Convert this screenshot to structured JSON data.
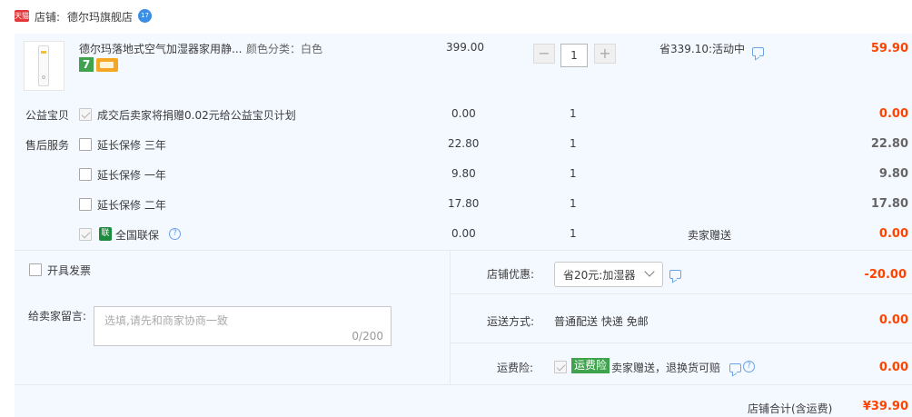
{
  "shop": {
    "badge": "天猫",
    "label": "店铺:",
    "name": "德尔玛旗舰店",
    "wangwang_badge": "17"
  },
  "product": {
    "title": "德尔玛落地式空气加湿器家用静...",
    "sku": "颜色分类：白色",
    "badge_7": "7",
    "price": "399.00",
    "quantity": "1",
    "minus": "−",
    "plus": "+",
    "discount": "省339.10:活动中",
    "subtotal": "59.90"
  },
  "extras": {
    "charity_label": "公益宝贝",
    "charity_text": "成交后卖家将捐赠0.02元给公益宝贝计划",
    "charity_price": "0.00",
    "charity_qty": "1",
    "charity_total": "0.00",
    "service_label": "售后服务",
    "services": [
      {
        "text": "延长保修 三年",
        "price": "22.80",
        "qty": "1",
        "total": "22.80"
      },
      {
        "text": "延长保修 一年",
        "price": "9.80",
        "qty": "1",
        "total": "9.80"
      },
      {
        "text": "延长保修 二年",
        "price": "17.80",
        "qty": "1",
        "total": "17.80"
      }
    ],
    "warranty_icon": "联",
    "warranty_text": "全国联保",
    "warranty_price": "0.00",
    "warranty_qty": "1",
    "warranty_note": "卖家赠送",
    "warranty_total": "0.00"
  },
  "order": {
    "invoice_label": "开具发票",
    "shop_discount_label": "店铺优惠:",
    "shop_discount_value": "省20元:加湿器",
    "shop_discount_amount": "-20.00",
    "message_label": "给卖家留言:",
    "message_placeholder": "选填,请先和商家协商一致",
    "message_counter": "0/200",
    "shipping_label": "运送方式:",
    "shipping_value": "普通配送 快递 免邮",
    "shipping_amount": "0.00",
    "insurance_label": "运费险:",
    "insurance_tag": "运费险",
    "insurance_text": "卖家赠送，退换货可赔",
    "insurance_amount": "0.00",
    "total_label": "店铺合计(含运费)",
    "total_value": "¥39.90"
  },
  "colors": {
    "accent_red": "#ff4400",
    "panel_bg": "#f4f8ff",
    "tag_green": "#3fa34d",
    "link_blue": "#6aa3e8"
  }
}
